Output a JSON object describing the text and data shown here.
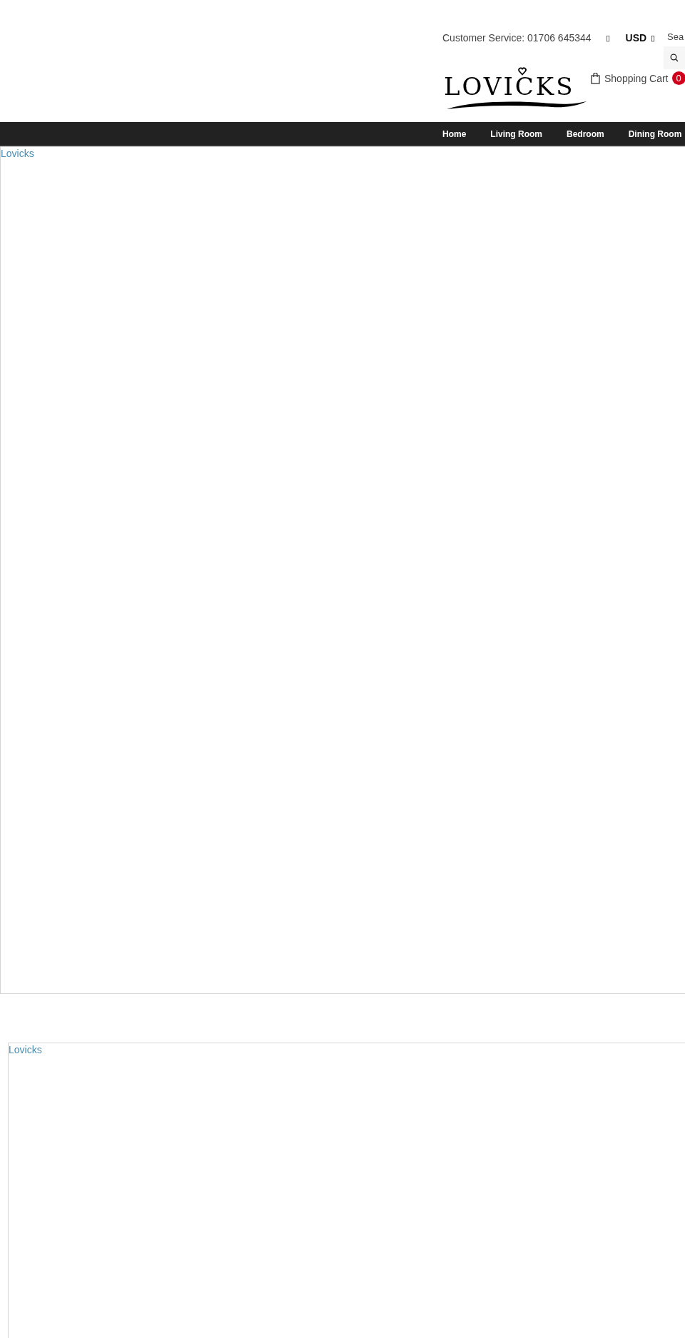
{
  "header": {
    "customer_service": "Customer Service: 01706 645344",
    "account_icon": "▯",
    "currency": "USD",
    "currency_caret": "▯",
    "search": {
      "placeholder": "Sea"
    },
    "logo": "LOVICKS",
    "cart": {
      "label": "Shopping Cart",
      "count": "0"
    }
  },
  "nav": {
    "items": [
      {
        "label": "Home"
      },
      {
        "label": "Living Room"
      },
      {
        "label": "Bedroom"
      },
      {
        "label": "Dining Room"
      }
    ]
  },
  "frames": [
    {
      "link": "Lovicks"
    },
    {
      "link": "Lovicks"
    }
  ]
}
